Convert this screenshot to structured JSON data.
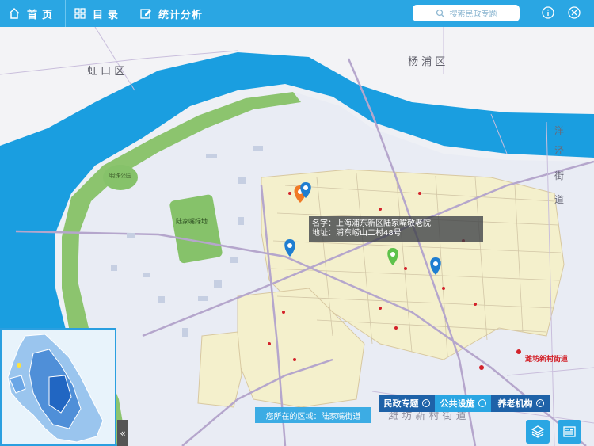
{
  "nav": {
    "home_label": "首页",
    "catalog_label": "目录",
    "stats_label": "统计分析"
  },
  "search": {
    "placeholder": "搜索民政专题"
  },
  "map": {
    "district_labels": [
      "杨浦区",
      "虹口区",
      "洋泾街道",
      "潍坊新村街道"
    ],
    "park_labels": [
      "明珠公园",
      "陆家嘴绿地"
    ],
    "district_label_yangpu": "杨 浦 区",
    "district_label_hongkou": "虹 口 区",
    "street_label_yangjing": "洋 泾 街 道",
    "street_label_weifang": "潍坊新村街道",
    "park_mingzhu": "明珠公园",
    "park_lujiazui": "陆家嘴绿地",
    "road_weifang": "潍 坊 新 村 街 道",
    "colors": {
      "river": "#1a9ee0",
      "land": "#eef0f7",
      "highlight": "#f4f0cc",
      "park": "#86c26a"
    }
  },
  "tooltip": {
    "name_line": "名字：上海浦东新区陆家嘴敬老院",
    "address_line": "地址：浦东崂山二村48号"
  },
  "region_bar": {
    "text": "您所在的区域：陆家嘴街道"
  },
  "filters": {
    "civil_label": "民政专题",
    "public_label": "公共设施",
    "elderly_label": "养老机构"
  },
  "icons": {
    "home": "home-icon",
    "catalog": "grid-icon",
    "stats": "edit-icon",
    "search": "search-icon",
    "info": "info-icon",
    "close": "close-icon",
    "layers": "layers-icon",
    "report": "document-icon"
  }
}
